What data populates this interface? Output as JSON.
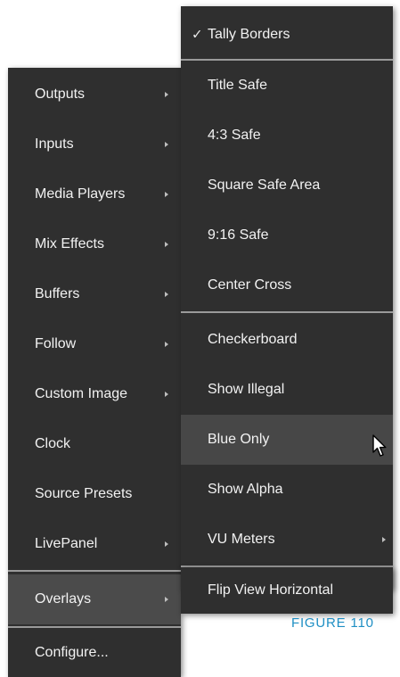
{
  "left_menu": {
    "items": [
      {
        "label": "Outputs",
        "arrow": true
      },
      {
        "label": "Inputs",
        "arrow": true
      },
      {
        "label": "Media Players",
        "arrow": true
      },
      {
        "label": "Mix Effects",
        "arrow": true
      },
      {
        "label": "Buffers",
        "arrow": true
      },
      {
        "label": "Follow",
        "arrow": true
      },
      {
        "label": "Custom Image",
        "arrow": true
      },
      {
        "label": "Clock",
        "arrow": false
      },
      {
        "label": "Source Presets",
        "arrow": false
      },
      {
        "label": "LivePanel",
        "arrow": true
      },
      {
        "label": "Overlays",
        "arrow": true,
        "highlighted": true
      },
      {
        "label": "Configure...",
        "arrow": false
      }
    ]
  },
  "overlays_submenu": {
    "check_glyph": "✓",
    "items": [
      {
        "label": "Tally Borders",
        "checked": true
      },
      {
        "label": "Title Safe"
      },
      {
        "label": "4:3 Safe"
      },
      {
        "label": "Square Safe Area"
      },
      {
        "label": "9:16 Safe"
      },
      {
        "label": "Center Cross"
      },
      {
        "label": "Checkerboard"
      },
      {
        "label": "Show Illegal"
      },
      {
        "label": "Blue Only",
        "hovered": true
      },
      {
        "label": "Show Alpha"
      },
      {
        "label": "VU Meters",
        "arrow": true
      },
      {
        "label": "Flip View Horizontal"
      }
    ]
  },
  "caption": "FIGURE 110",
  "colors": {
    "menu_bg": "#2f2f2f",
    "highlight_bg": "#4b4b4b",
    "hover_bg": "#474747",
    "text": "#f2f2f2",
    "caption": "#1f8fc4"
  },
  "icons": {
    "submenu_arrow": "triangle-right",
    "cursor": "mouse-pointer"
  }
}
